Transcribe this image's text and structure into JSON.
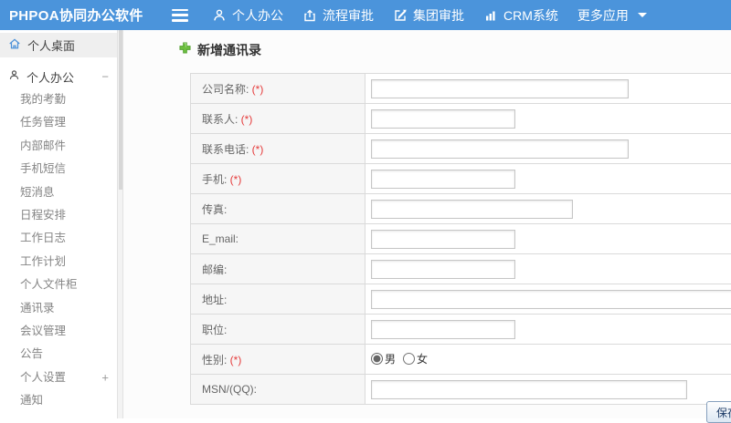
{
  "colors": {
    "topbar_blue": "#4b94db",
    "accent_green": "#6cbf3f",
    "required_red": "#e53b3b",
    "sidebar_icon_blue": "#4a90d9"
  },
  "topbar": {
    "logo": "PHPOA协同办公软件",
    "nav": [
      {
        "label": "个人办公"
      },
      {
        "label": "流程审批"
      },
      {
        "label": "集团审批"
      },
      {
        "label": "CRM系统"
      },
      {
        "label": "更多应用"
      }
    ]
  },
  "sidebar": {
    "home": "个人桌面",
    "group": "个人办公",
    "group_collapse": "−",
    "items": [
      "我的考勤",
      "任务管理",
      "内部邮件",
      "手机短信",
      "短消息",
      "日程安排",
      "工作日志",
      "工作计划",
      "个人文件柜",
      "通讯录",
      "会议管理",
      "公告"
    ],
    "settings": "个人设置",
    "settings_expand": "+",
    "notice": "通知"
  },
  "form": {
    "title": "新增通讯录",
    "required_marker": "(*)",
    "fields": [
      {
        "name": "company-name",
        "label": "公司名称:",
        "required": true,
        "size": "lg"
      },
      {
        "name": "contact-person",
        "label": "联系人:",
        "required": true,
        "size": "sm"
      },
      {
        "name": "contact-phone",
        "label": "联系电话:",
        "required": true,
        "size": "lg"
      },
      {
        "name": "mobile",
        "label": "手机:",
        "required": true,
        "size": "sm"
      },
      {
        "name": "fax",
        "label": "传真:",
        "required": false,
        "size": "md"
      },
      {
        "name": "email",
        "label": "E_mail:",
        "required": false,
        "size": "sm"
      },
      {
        "name": "zipcode",
        "label": "邮编:",
        "required": false,
        "size": "sm"
      },
      {
        "name": "address",
        "label": "地址:",
        "required": false,
        "size": "xl"
      },
      {
        "name": "position",
        "label": "职位:",
        "required": false,
        "size": "sm"
      },
      {
        "name": "gender",
        "label": "性别:",
        "required": true,
        "type": "radio",
        "options": [
          {
            "label": "男",
            "checked": true
          },
          {
            "label": "女",
            "checked": false
          }
        ]
      },
      {
        "name": "msn-qq",
        "label": "MSN/(QQ):",
        "required": false,
        "size": "qq"
      }
    ],
    "save_label": "保存"
  }
}
